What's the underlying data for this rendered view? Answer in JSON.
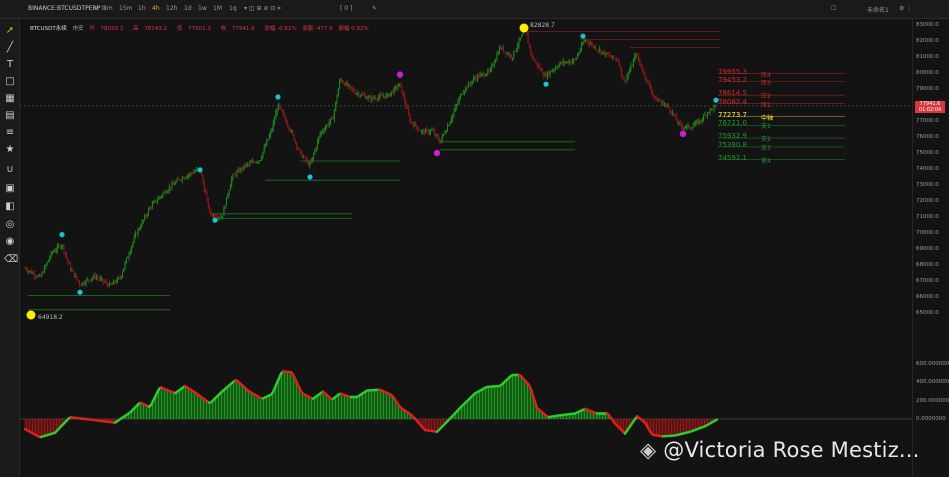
{
  "topbar": {
    "pair": "BINANCE:BTCUSDTPERP",
    "timeframes": [
      "3m",
      "15m",
      "1h",
      "4h",
      "12h",
      "1d",
      "1w",
      "1M",
      "1q"
    ],
    "active_tf": "4h",
    "layout": "[ 0 ]",
    "right_label": "未命名1"
  },
  "legend": {
    "symbol": "BTCUSDT永续",
    "status": "市安",
    "open_label": "开",
    "open": "78029.2",
    "high_label": "高",
    "high": "78143.2",
    "low_label": "低",
    "low": "77501.3",
    "close_label": "收",
    "close": "77941.6",
    "chg1": "涨幅 -0.61%",
    "chg2": "涨额 -477.5",
    "chg3": "振幅 0.82%"
  },
  "price_axis": {
    "labels": [
      "83000.0",
      "82000.0",
      "81000.0",
      "80000.0",
      "79000.0",
      "78000.0",
      "77000.0",
      "76000.0",
      "75000.0",
      "74000.0",
      "73000.0",
      "72000.0",
      "71000.0",
      "70000.0",
      "69000.0",
      "68000.0",
      "67000.0",
      "66000.0",
      "65000.0"
    ],
    "last_price": "77941.6",
    "last_time": "01:02:04"
  },
  "osc_axis": {
    "labels": [
      "600.0000000",
      "400.0000000",
      "200.0000000",
      "0.0000000"
    ]
  },
  "extremes": {
    "high": "82828.7",
    "low": "64918.2"
  },
  "levels": {
    "resistance": [
      {
        "price": "79955.3",
        "tag": "压4"
      },
      {
        "price": "79453.2",
        "tag": "压3"
      },
      {
        "price": "78614.5",
        "tag": "压2"
      },
      {
        "price": "78082.4",
        "tag": "压1"
      }
    ],
    "mid": {
      "price": "77273.7",
      "tag": "中轴"
    },
    "support": [
      {
        "price": "76721.0",
        "tag": "支1"
      },
      {
        "price": "75932.9",
        "tag": "支2"
      },
      {
        "price": "75380.8",
        "tag": "支3"
      },
      {
        "price": "74592.1",
        "tag": "支4"
      }
    ]
  },
  "colors": {
    "bull": "#1e8a1e",
    "bear": "#8a1a1a",
    "osc_bull": "#2ecc2e",
    "osc_bear": "#e02020",
    "pivot_high": "#19c4d4",
    "pivot_low": "#d01ad0",
    "extreme": "#ffee00",
    "mid": "#ffee33"
  },
  "watermark": "@Victoria Rose Mestiz..."
}
